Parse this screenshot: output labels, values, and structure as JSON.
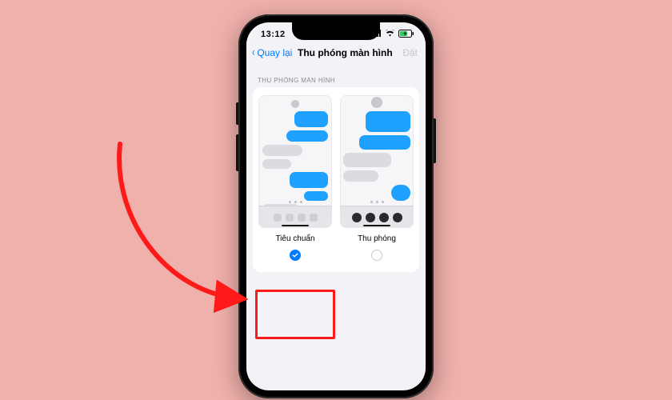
{
  "status": {
    "time": "13:12"
  },
  "nav": {
    "back_label": "Quay lại",
    "title": "Thu phóng màn hình",
    "right_label": "Đặt"
  },
  "section": {
    "header": "THU PHÓNG MÀN HÌNH"
  },
  "options": {
    "standard": {
      "label": "Tiêu chuẩn",
      "selected": true
    },
    "zoomed": {
      "label": "Thu phóng",
      "selected": false
    }
  },
  "colors": {
    "accent": "#007aff",
    "highlight": "#ff1a1a"
  }
}
